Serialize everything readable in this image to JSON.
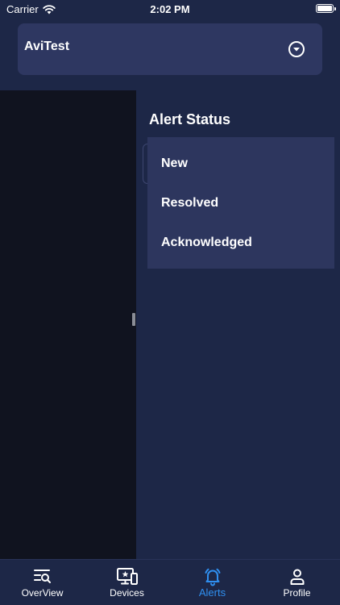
{
  "status_bar": {
    "carrier": "Carrier",
    "time": "2:02 PM",
    "battery_level": 1.0
  },
  "header": {
    "title": "AviTest",
    "icon": "chevron-circle-down-icon"
  },
  "panel": {
    "title": "Alert Status",
    "menu_items": [
      {
        "label": "New"
      },
      {
        "label": "Resolved"
      },
      {
        "label": "Acknowledged"
      }
    ]
  },
  "tab_bar": {
    "tabs": [
      {
        "label": "OverView",
        "icon": "overview-search-icon",
        "active": false
      },
      {
        "label": "Devices",
        "icon": "devices-icon",
        "active": false
      },
      {
        "label": "Alerts",
        "icon": "bell-icon",
        "active": true
      },
      {
        "label": "Profile",
        "icon": "person-icon",
        "active": false
      }
    ]
  },
  "colors": {
    "background": "#1d2747",
    "card": "#2e3761",
    "menu": "#2d365e",
    "overlay": "#10131f",
    "accent": "#2f8ff0",
    "text": "#ffffff"
  }
}
